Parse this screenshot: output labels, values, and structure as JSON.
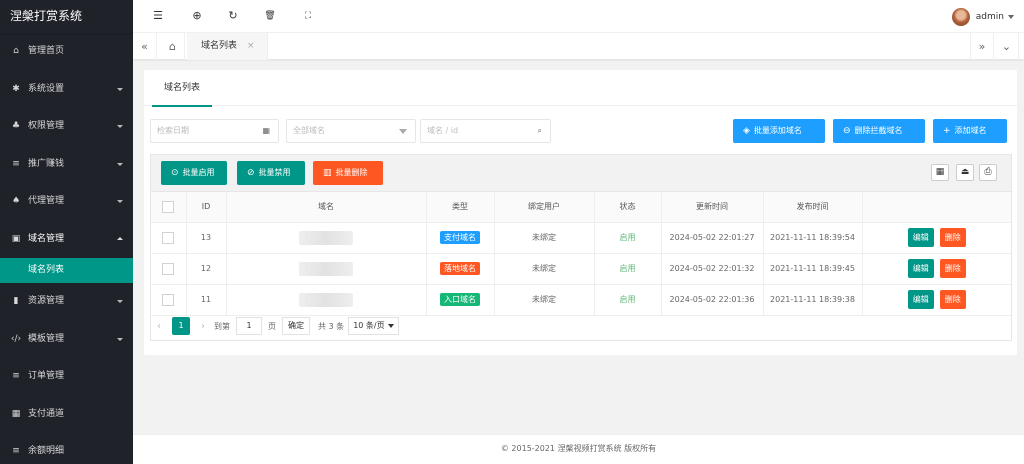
{
  "app": {
    "title": "涅槃打赏系统"
  },
  "sidebar": {
    "items": [
      {
        "label": "管理首页",
        "icon": "home-icon",
        "glyph": "⌂",
        "has_arrow": false
      },
      {
        "label": "系统设置",
        "icon": "gear-icon",
        "glyph": "✱",
        "has_arrow": true
      },
      {
        "label": "权限管理",
        "icon": "users-icon",
        "glyph": "♣",
        "has_arrow": true
      },
      {
        "label": "推广赚钱",
        "icon": "list-icon",
        "glyph": "≡",
        "has_arrow": true
      },
      {
        "label": "代理管理",
        "icon": "group-icon",
        "glyph": "♠",
        "has_arrow": true
      },
      {
        "label": "域名管理",
        "icon": "grid-icon",
        "glyph": "▣",
        "has_arrow": true,
        "open": true
      }
    ],
    "sub_items": [
      {
        "label": "域名列表",
        "active": true
      }
    ],
    "items_after": [
      {
        "label": "资源管理",
        "icon": "book-icon",
        "glyph": "▮",
        "has_arrow": true
      },
      {
        "label": "模板管理",
        "icon": "code-icon",
        "glyph": "‹/›",
        "has_arrow": true
      },
      {
        "label": "订单管理",
        "icon": "list-icon",
        "glyph": "≡",
        "has_arrow": false
      },
      {
        "label": "支付通道",
        "icon": "apps-icon",
        "glyph": "▦",
        "has_arrow": false
      },
      {
        "label": "余额明细",
        "icon": "list-icon",
        "glyph": "≡",
        "has_arrow": false
      }
    ]
  },
  "header": {
    "icons": [
      "menu-collapse-icon",
      "globe-icon",
      "refresh-icon",
      "trash-icon",
      "fullscreen-icon"
    ],
    "user": "admin"
  },
  "tabs": {
    "active": "域名列表",
    "close": "×"
  },
  "card": {
    "tab": "域名列表",
    "filters": {
      "date_placeholder": "检索日期",
      "type_placeholder": "全部域名",
      "keyword_placeholder": "域名 / id"
    },
    "actions": {
      "batch_add": "批量添加域名",
      "delete_blocked": "删除拦截域名",
      "add": "添加域名"
    },
    "toolbar": {
      "enable": "批量启用",
      "disable": "批量禁用",
      "delete": "批量删除"
    },
    "table": {
      "columns": [
        "ID",
        "域名",
        "类型",
        "绑定用户",
        "状态",
        "更新时间",
        "发布时间",
        ""
      ],
      "rows": [
        {
          "id": "13",
          "type": "支付域名",
          "type_color": "#1e9fff",
          "user": "未绑定",
          "status": "启用",
          "updated": "2024-05-02 22:01:27",
          "published": "2021-11-11 18:39:54"
        },
        {
          "id": "12",
          "type": "落地域名",
          "type_color": "#ff5722",
          "user": "未绑定",
          "status": "启用",
          "updated": "2024-05-02 22:01:32",
          "published": "2021-11-11 18:39:45"
        },
        {
          "id": "11",
          "type": "入口域名",
          "type_color": "#16b777",
          "user": "未绑定",
          "status": "启用",
          "updated": "2024-05-02 22:01:36",
          "published": "2021-11-11 18:39:38"
        }
      ],
      "edit": "编辑",
      "delete": "删除"
    },
    "pager": {
      "current": "1",
      "goto": "到第",
      "page_input": "1",
      "page_unit": "页",
      "confirm": "确定",
      "total": "共 3 条",
      "per_page": "10 条/页"
    }
  },
  "footer": {
    "copyright": "© 2015-2021 涅槃视频打赏系统 版权所有"
  }
}
